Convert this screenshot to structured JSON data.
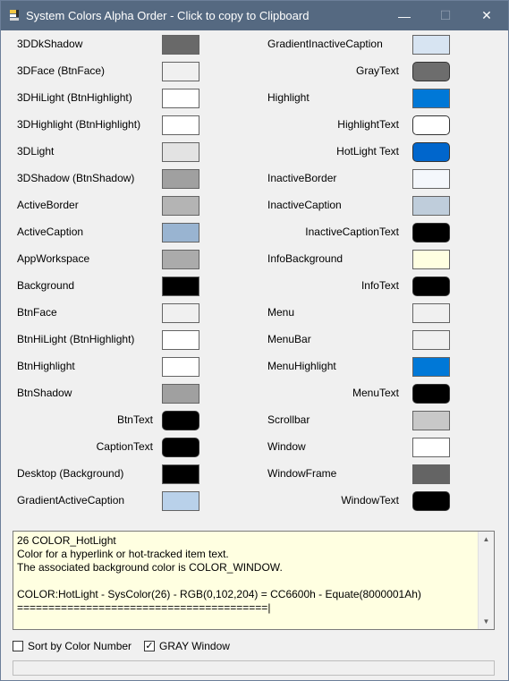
{
  "window": {
    "title": "System Colors Alpha Order - Click to copy to Clipboard",
    "minimize": "—",
    "maximize": "☐",
    "close": "✕"
  },
  "left_column": [
    {
      "label": "3DDkShadow",
      "color": "#696969",
      "align": "left"
    },
    {
      "label": "3DFace  (BtnFace)",
      "color": "#f0f0f0",
      "align": "left"
    },
    {
      "label": "3DHiLight  (BtnHighlight)",
      "color": "#ffffff",
      "align": "left"
    },
    {
      "label": "3DHighlight (BtnHighlight)",
      "color": "#ffffff",
      "align": "left"
    },
    {
      "label": "3DLight",
      "color": "#e3e3e3",
      "align": "left"
    },
    {
      "label": "3DShadow   (BtnShadow)",
      "color": "#a0a0a0",
      "align": "left"
    },
    {
      "label": "ActiveBorder",
      "color": "#b4b4b4",
      "align": "left"
    },
    {
      "label": "ActiveCaption",
      "color": "#99b4d1",
      "align": "left"
    },
    {
      "label": "AppWorkspace",
      "color": "#ababab",
      "align": "left"
    },
    {
      "label": "Background",
      "color": "#000000",
      "align": "left"
    },
    {
      "label": "BtnFace",
      "color": "#f0f0f0",
      "align": "left"
    },
    {
      "label": "BtnHiLight (BtnHighlight)",
      "color": "#ffffff",
      "align": "left"
    },
    {
      "label": "BtnHighlight",
      "color": "#ffffff",
      "align": "left"
    },
    {
      "label": "BtnShadow",
      "color": "#a0a0a0",
      "align": "left"
    },
    {
      "label": "BtnText",
      "color": "#000000",
      "align": "right",
      "rounded": true
    },
    {
      "label": "CaptionText",
      "color": "#000000",
      "align": "right",
      "rounded": true
    },
    {
      "label": "Desktop    (Background)",
      "color": "#000000",
      "align": "left"
    },
    {
      "label": "GradientActiveCaption",
      "color": "#b9d1ea",
      "align": "left"
    }
  ],
  "right_column": [
    {
      "label": "GradientInactiveCaption",
      "color": "#d7e4f2",
      "align": "left"
    },
    {
      "label": "GrayText",
      "color": "#6d6d6d",
      "align": "right",
      "rounded": true
    },
    {
      "label": "Highlight",
      "color": "#0078d7",
      "align": "left"
    },
    {
      "label": "HighlightText",
      "color": "#ffffff",
      "align": "right",
      "rounded": true
    },
    {
      "label": "HotLight Text",
      "color": "#0066cc",
      "align": "right",
      "rounded": true
    },
    {
      "label": "InactiveBorder",
      "color": "#f4f7fc",
      "align": "left"
    },
    {
      "label": "InactiveCaption",
      "color": "#bfcddb",
      "align": "left"
    },
    {
      "label": "InactiveCaptionText",
      "color": "#000000",
      "align": "right",
      "rounded": true
    },
    {
      "label": "InfoBackground",
      "color": "#ffffe1",
      "align": "left"
    },
    {
      "label": "InfoText",
      "color": "#000000",
      "align": "right",
      "rounded": true
    },
    {
      "label": "Menu",
      "color": "#f0f0f0",
      "align": "left"
    },
    {
      "label": "MenuBar",
      "color": "#f0f0f0",
      "align": "left"
    },
    {
      "label": "MenuHighlight",
      "color": "#0078d7",
      "align": "left"
    },
    {
      "label": "MenuText",
      "color": "#000000",
      "align": "right",
      "rounded": true
    },
    {
      "label": "Scrollbar",
      "color": "#c8c8c8",
      "align": "left"
    },
    {
      "label": "Window",
      "color": "#ffffff",
      "align": "left"
    },
    {
      "label": "WindowFrame",
      "color": "#646464",
      "align": "left"
    },
    {
      "label": "WindowText",
      "color": "#000000",
      "align": "right",
      "rounded": true
    }
  ],
  "info": {
    "text": "26 COLOR_HotLight\nColor for a hyperlink or hot-tracked item text.\nThe associated background color is COLOR_WINDOW.\n\nCOLOR:HotLight - SysColor(26) - RGB(0,102,204) = CC6600h - Equate(8000001Ah)\n========================================|",
    "scroll_up": "▲",
    "scroll_down": "▼"
  },
  "options": {
    "sort_by_number": {
      "label": "Sort by Color Number",
      "checked": false,
      "mark": ""
    },
    "gray_window": {
      "label": "GRAY Window",
      "checked": true,
      "mark": "✓"
    }
  },
  "icons": {
    "app": "app-window-icon"
  }
}
